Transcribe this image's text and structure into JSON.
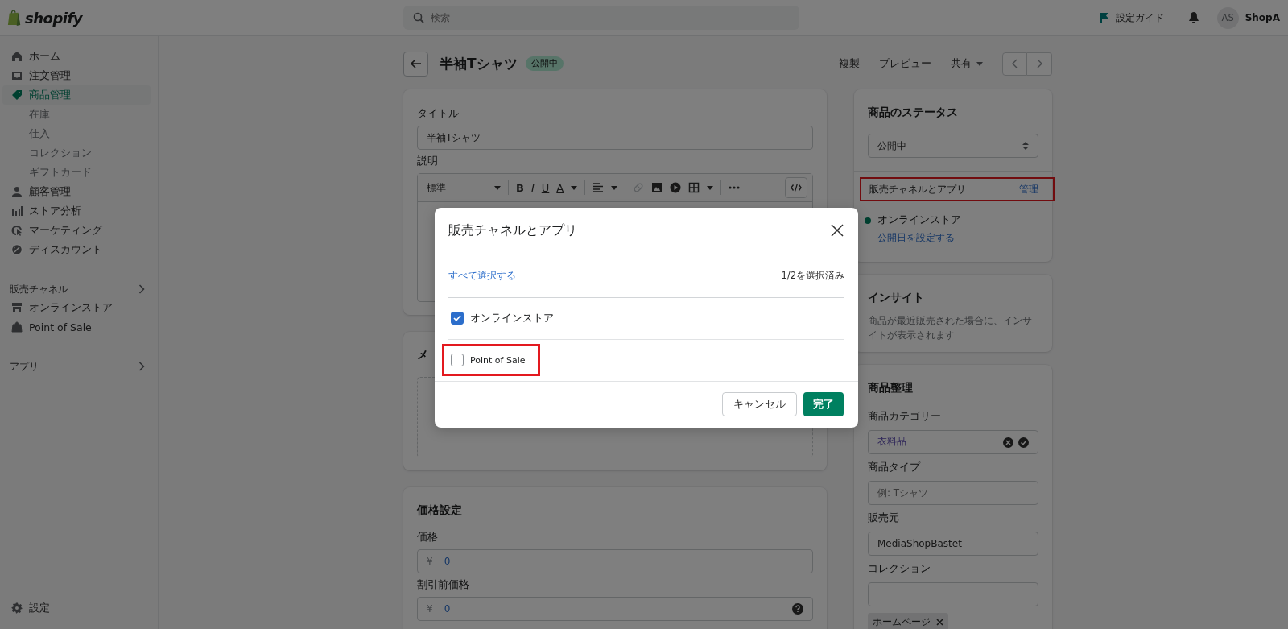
{
  "topbar": {
    "logo": "shopify",
    "search": {
      "placeholder": "検索"
    },
    "setup_guide": "設定ガイド",
    "avatar": "AS",
    "store": "ShopA"
  },
  "sidebar": {
    "nav": [
      {
        "label": "ホーム",
        "selected": false
      },
      {
        "label": "注文管理",
        "selected": false
      },
      {
        "label": "商品管理",
        "selected": true,
        "children": [
          {
            "label": "在庫"
          },
          {
            "label": "仕入"
          },
          {
            "label": "コレクション"
          },
          {
            "label": "ギフトカード"
          }
        ]
      },
      {
        "label": "顧客管理",
        "selected": false
      },
      {
        "label": "ストア分析",
        "selected": false
      },
      {
        "label": "マーケティング",
        "selected": false
      },
      {
        "label": "ディスカウント",
        "selected": false
      }
    ],
    "channels_header": "販売チャネル",
    "channels": [
      {
        "label": "オンラインストア"
      },
      {
        "label": "Point of Sale"
      }
    ],
    "apps_header": "アプリ",
    "settings": "設定"
  },
  "page": {
    "title": "半袖Tシャツ",
    "status_badge": "公開中",
    "actions": [
      "複製",
      "プレビュー",
      "共有"
    ]
  },
  "product_card": {
    "title_label": "タイトル",
    "title_value": "半袖Tシャツ",
    "description_label": "説明",
    "format": "標準",
    "text_buttons": [
      "B",
      "I",
      "U",
      "A"
    ]
  },
  "media_card": {
    "title": "メ"
  },
  "pricing": {
    "title": "価格設定",
    "price_label": "価格",
    "price_currency": "¥",
    "price_value": "0",
    "compare_label": "割引前価格",
    "compare_currency": "¥",
    "compare_value": "0"
  },
  "status_card": {
    "title": "商品のステータス",
    "status_value": "公開中",
    "channels_label": "販売チャネルとアプリ",
    "manage": "管理",
    "highlighted": true,
    "channels": [
      {
        "name": "オンラインストア"
      }
    ],
    "schedule_link": "公開日を設定する"
  },
  "insights": {
    "title": "インサイト",
    "text": "商品が最近販売された場合に、インサイトが表示されます"
  },
  "organization": {
    "title": "商品整理",
    "category_label": "商品カテゴリー",
    "category_value": "衣料品",
    "type_label": "商品タイプ",
    "type_placeholder": "例: Tシャツ",
    "vendor_label": "販売元",
    "vendor_value": "MediaShopBastet",
    "collections_label": "コレクション",
    "collection_tags": [
      "ホームページ"
    ]
  },
  "modal": {
    "title": "販売チャネルとアプリ",
    "select_all": "すべて選択する",
    "count": "1/2を選択済み",
    "options": [
      {
        "label": "オンラインストア",
        "checked": true,
        "highlighted": false
      },
      {
        "label": "Point of Sale",
        "checked": false,
        "highlighted": true
      }
    ],
    "cancel": "キャンセル",
    "done": "完了"
  }
}
